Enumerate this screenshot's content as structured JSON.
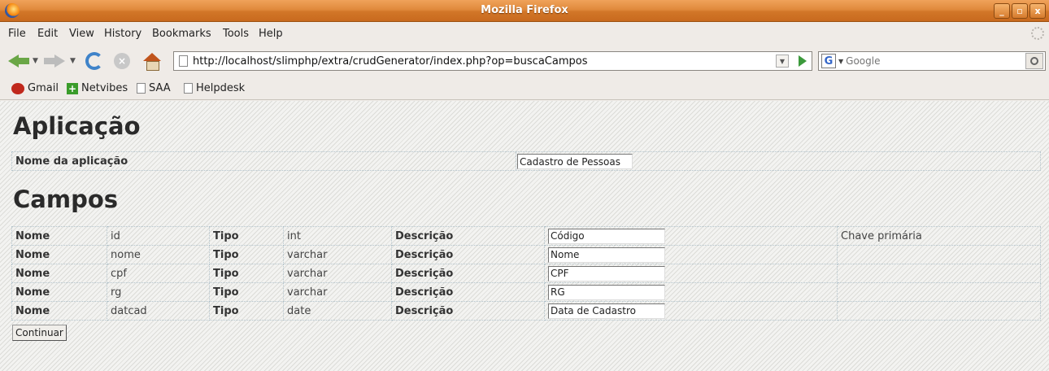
{
  "window": {
    "title": "Mozilla Firefox",
    "buttons": [
      "_",
      "▫",
      "x"
    ]
  },
  "menu": [
    "File",
    "Edit",
    "View",
    "History",
    "Bookmarks",
    "Tools",
    "Help"
  ],
  "nav": {
    "url": "http://localhost/slimphp/extra/crudGenerator/index.php?op=buscaCampos",
    "search_placeholder": "Google",
    "search_engine_glyph": "G"
  },
  "bookmarks": [
    {
      "label": "Gmail",
      "icon": "gmail-icon"
    },
    {
      "label": "Netvibes",
      "icon": "netvibes-icon"
    },
    {
      "label": "SAA",
      "icon": "page-icon"
    },
    {
      "label": "Helpdesk",
      "icon": "page-icon"
    }
  ],
  "app_section": {
    "heading": "Aplicação",
    "label": "Nome da aplicação",
    "value": "Cadastro de Pessoas"
  },
  "fields_section": {
    "heading": "Campos",
    "rows": [
      {
        "nome_label": "Nome",
        "nome": "id",
        "tipo_label": "Tipo",
        "tipo": "int",
        "desc_label": "Descrição",
        "desc": "Código",
        "extra": "Chave primária"
      },
      {
        "nome_label": "Nome",
        "nome": "nome",
        "tipo_label": "Tipo",
        "tipo": "varchar",
        "desc_label": "Descrição",
        "desc": "Nome",
        "extra": ""
      },
      {
        "nome_label": "Nome",
        "nome": "cpf",
        "tipo_label": "Tipo",
        "tipo": "varchar",
        "desc_label": "Descrição",
        "desc": "CPF",
        "extra": ""
      },
      {
        "nome_label": "Nome",
        "nome": "rg",
        "tipo_label": "Tipo",
        "tipo": "varchar",
        "desc_label": "Descrição",
        "desc": "RG",
        "extra": ""
      },
      {
        "nome_label": "Nome",
        "nome": "datcad",
        "tipo_label": "Tipo",
        "tipo": "date",
        "desc_label": "Descrição",
        "desc": "Data de Cadastro",
        "extra": ""
      }
    ]
  },
  "submit_label": "Continuar"
}
